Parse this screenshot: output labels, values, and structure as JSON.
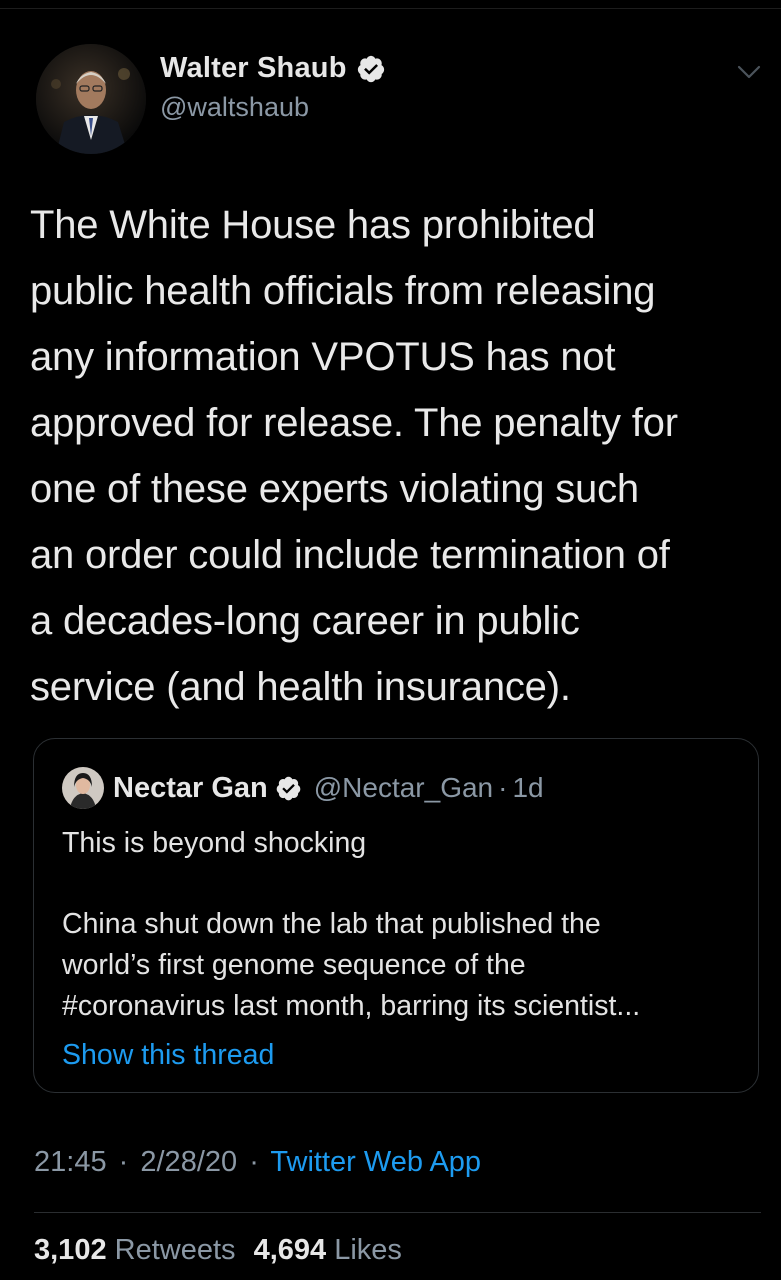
{
  "author": {
    "display_name": "Walter Shaub",
    "handle": "@waltshaub"
  },
  "tweet": {
    "lines": [
      "The White House has prohibited",
      "public health officials from releasing",
      "any information VPOTUS has not",
      "approved for release. The penalty for",
      "one of these experts violating such",
      "an order could include termination of",
      "a decades-long career in public",
      "service (and health insurance)."
    ]
  },
  "quoted_tweet": {
    "display_name": "Nectar Gan",
    "handle": "@Nectar_Gan",
    "separator": "·",
    "age": "1d",
    "lines": [
      "This is beyond shocking",
      "China shut down the lab that published the",
      "world’s first genome sequence of the",
      "#coronavirus last month, barring its scientist..."
    ],
    "show_thread": "Show this thread"
  },
  "meta": {
    "time": "21:45",
    "sep1": "·",
    "date": "2/28/20",
    "sep2": "·",
    "source": "Twitter Web App"
  },
  "stats": {
    "retweets_count": "3,102",
    "retweets_label": "Retweets",
    "likes_count": "4,694",
    "likes_label": "Likes"
  },
  "colors": {
    "background": "#000000",
    "link": "#1d9bf0",
    "secondary": "#8b98a5"
  }
}
